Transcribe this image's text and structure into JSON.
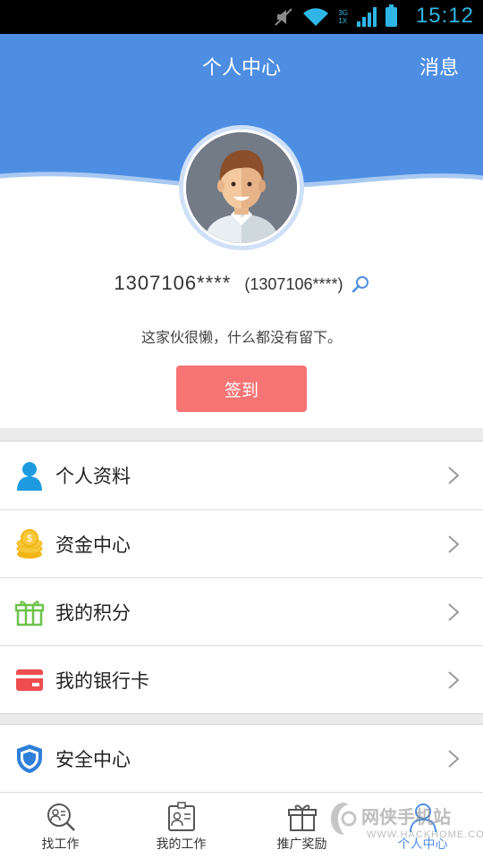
{
  "status_bar": {
    "time": "15:12",
    "network_type": "3G",
    "network_sub": "1X"
  },
  "header": {
    "title": "个人中心",
    "messages_label": "消息"
  },
  "profile": {
    "username": "1307106****",
    "account": "(1307106****)",
    "signature": "这家伙很懒，什么都没有留下。",
    "checkin_label": "签到"
  },
  "menu": {
    "group1": [
      {
        "label": "个人资料",
        "icon": "person-icon"
      },
      {
        "label": "资金中心",
        "icon": "coins-icon"
      },
      {
        "label": "我的积分",
        "icon": "gift-icon"
      },
      {
        "label": "我的银行卡",
        "icon": "bank-card-icon"
      }
    ],
    "group2": [
      {
        "label": "安全中心",
        "icon": "shield-icon"
      }
    ]
  },
  "tabs": [
    {
      "label": "找工作",
      "icon": "search-person-icon",
      "active": false
    },
    {
      "label": "我的工作",
      "icon": "badge-icon",
      "active": false
    },
    {
      "label": "推广奖励",
      "icon": "gift-icon",
      "active": false
    },
    {
      "label": "个人中心",
      "icon": "person-outline-icon",
      "active": true
    }
  ],
  "watermark": {
    "cn": "网侠手机站",
    "en": "WWW.HACKHOME.COM"
  },
  "colors": {
    "primary": "#4d8ee3",
    "checkin": "#f67474",
    "background": "#ebebeb"
  }
}
